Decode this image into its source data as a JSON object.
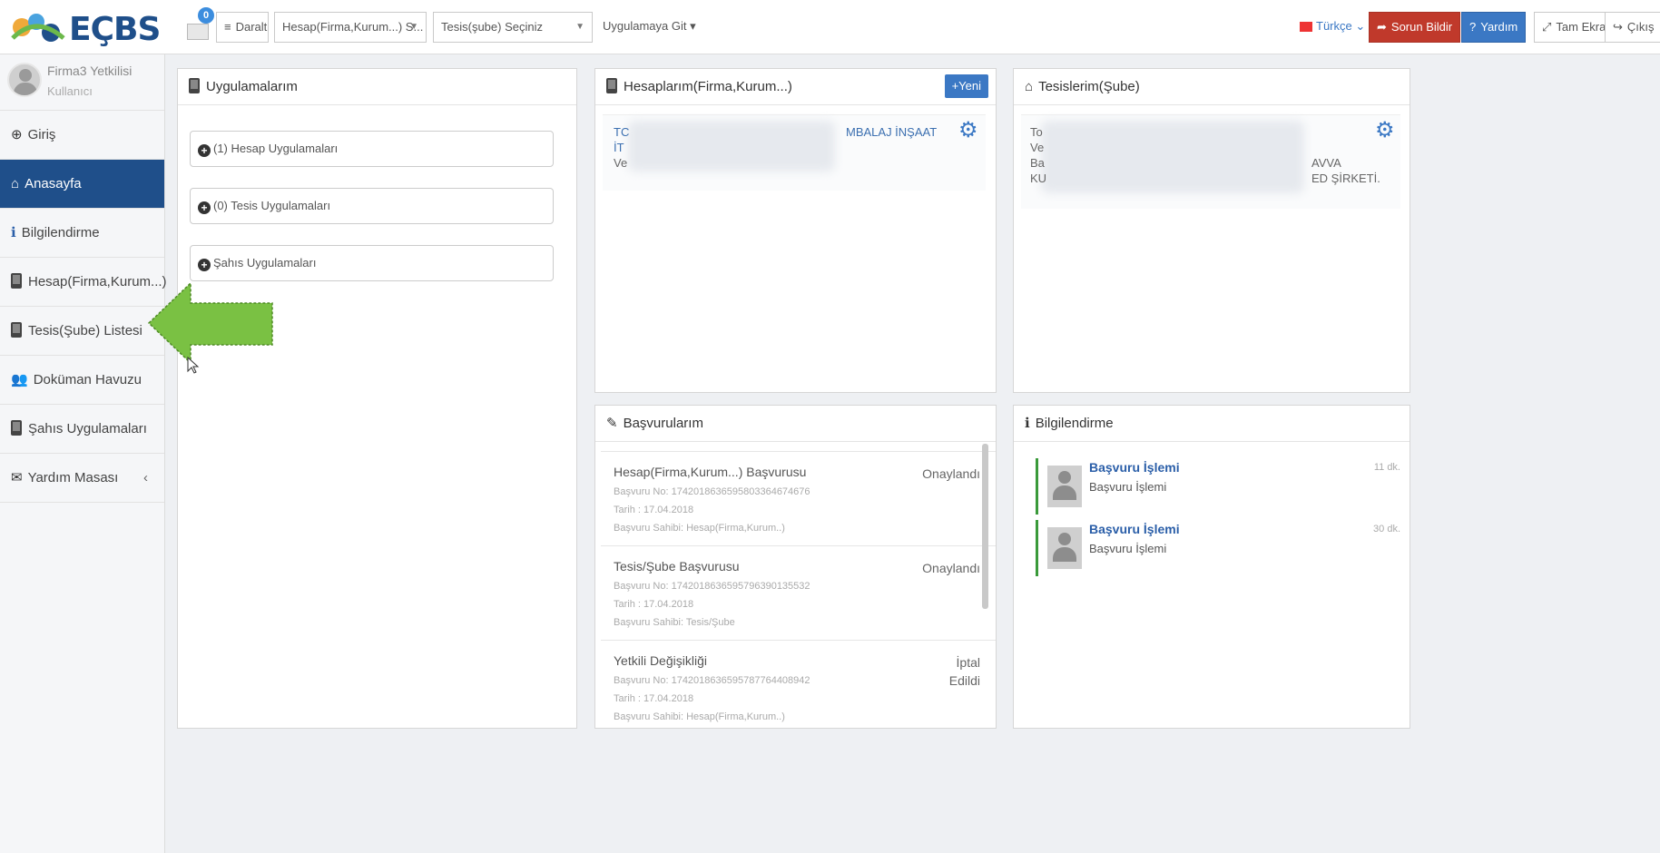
{
  "app": {
    "logo_text": "EÇBS",
    "brand_color": "#1f4f8a"
  },
  "topbar": {
    "mail_badge": "0",
    "collapse_label": "Daralt",
    "account_select": "Hesap(Firma,Kurum...) S...",
    "branch_select": "Tesis(şube) Seçiniz",
    "goto_app": "Uygulamaya Git",
    "language": "Türkçe",
    "report_issue": "Sorun Bildir",
    "help": "Yardım",
    "fullscreen": "Tam Ekran",
    "logout": "Çıkış"
  },
  "sidebar": {
    "user_name": "Firma3 Yetkilisi",
    "user_role": "Kullanıcı",
    "items": [
      {
        "label": "Giriş",
        "icon": "sign-in-icon"
      },
      {
        "label": "Anasayfa",
        "icon": "home-icon"
      },
      {
        "label": "Bilgilendirme",
        "icon": "info-icon"
      },
      {
        "label": "Hesap(Firma,Kurum...)",
        "icon": "phone-icon"
      },
      {
        "label": "Tesis(Şube) Listesi",
        "icon": "phone-icon"
      },
      {
        "label": "Doküman Havuzu",
        "icon": "users-icon"
      },
      {
        "label": "Şahıs Uygulamaları",
        "icon": "phone-icon"
      },
      {
        "label": "Yardım Masası",
        "icon": "envelope-icon"
      }
    ]
  },
  "apps_panel": {
    "title": "Uygulamalarım",
    "items": [
      "(1) Hesap Uygulamaları",
      "(0) Tesis Uygulamaları",
      "Şahıs Uygulamaları"
    ]
  },
  "accounts_panel": {
    "title": "Hesaplarım(Firma,Kurum...)",
    "new_button": "Yeni",
    "card_line1_start": "TC",
    "card_line1_end": "MBALAJ İNŞAAT",
    "card_line2_start": "İT",
    "card_line3_start": "Ve"
  },
  "branches_panel": {
    "title": "Tesislerim(Şube)",
    "card_line1_start": "To",
    "card_line2_start": "Ve",
    "card_line3_start": "Ba",
    "card_line3_end": "AVVA",
    "card_line4_start": "KU",
    "card_line4_end": "ED ŞİRKETİ."
  },
  "applications_panel": {
    "title": "Başvurularım",
    "items": [
      {
        "title": "Hesap(Firma,Kurum...) Başvurusu",
        "status": "Onaylandı",
        "no": "Başvuru No: 174201863659580336467467​6",
        "date": "Tarih : 17.04.2018",
        "owner": "Başvuru Sahibi: Hesap(Firma,Kurum..)"
      },
      {
        "title": "Tesis/Şube Başvurusu",
        "status": "Onaylandı",
        "no": "Başvuru No: 174201863659579639013553​2",
        "date": "Tarih : 17.04.2018",
        "owner": "Başvuru Sahibi: Tesis/Şube"
      },
      {
        "title": "Yetkili Değişikliği",
        "status_line1": "İptal",
        "status_line2": "Edildi",
        "no": "Başvuru No: 174201863659578776440894​2",
        "date": "Tarih : 17.04.2018",
        "owner": "Başvuru Sahibi: Hesap(Firma,Kurum..)"
      }
    ]
  },
  "info_panel": {
    "title": "Bilgilendirme",
    "items": [
      {
        "title": "Başvuru İşlemi",
        "desc": "Başvuru İşlemi",
        "time": "11 dk."
      },
      {
        "title": "Başvuru İşlemi",
        "desc": "Başvuru İşlemi",
        "time": "30 dk."
      }
    ]
  },
  "colors": {
    "active_nav": "#1f4f8a",
    "report_red": "#c0392b",
    "help_blue": "#3b78c4",
    "arrow_green": "#7ac143"
  }
}
